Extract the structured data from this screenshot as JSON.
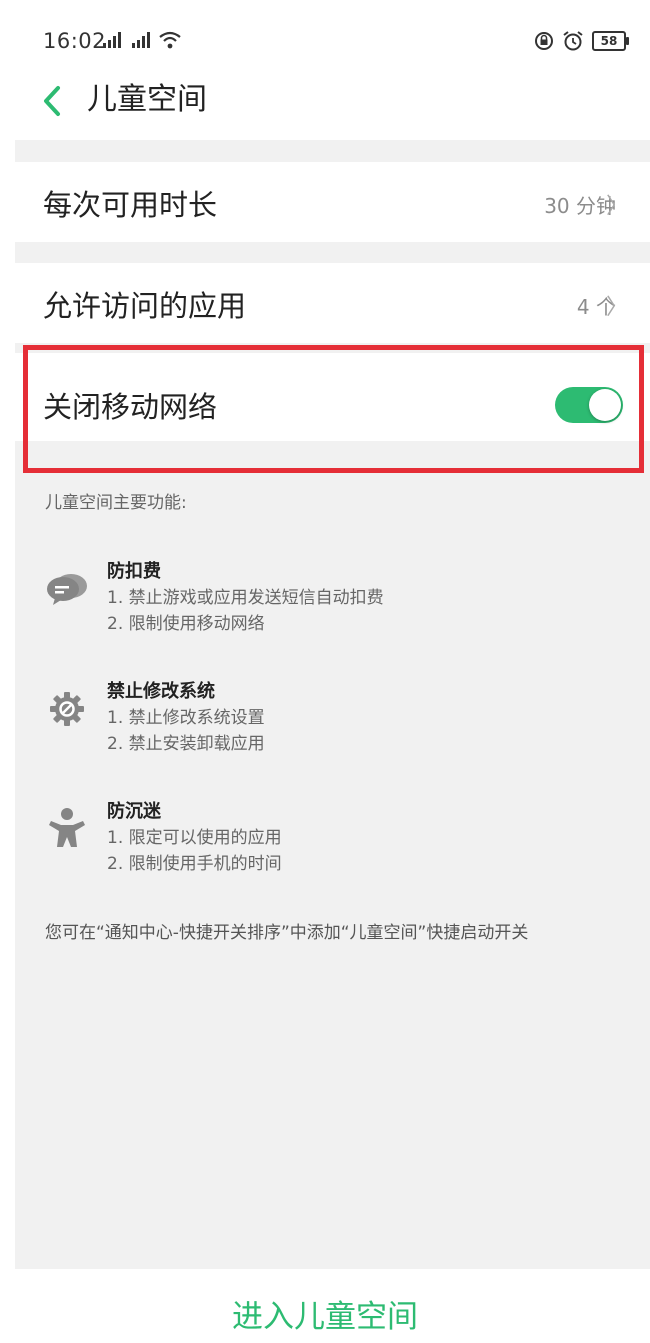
{
  "status_bar": {
    "time": "16:02",
    "battery": "58"
  },
  "header": {
    "title": "儿童空间"
  },
  "settings": {
    "duration_label": "每次可用时长",
    "duration_value": "30 分钟",
    "apps_label": "允许访问的应用",
    "apps_value": "4 个",
    "mobile_label": "关闭移动网络",
    "mobile_on": true
  },
  "features": {
    "title": "儿童空间主要功能:",
    "items": [
      {
        "icon": "chat-bubbles-icon",
        "title": "防扣费",
        "lines": [
          "1. 禁止游戏或应用发送短信自动扣费",
          "2. 限制使用移动网络"
        ]
      },
      {
        "icon": "gear-forbid-icon",
        "title": "禁止修改系统",
        "lines": [
          "1. 禁止修改系统设置",
          "2. 禁止安装卸载应用"
        ]
      },
      {
        "icon": "child-figure-icon",
        "title": "防沉迷",
        "lines": [
          "1. 限定可以使用的应用",
          "2. 限制使用手机的时间"
        ]
      }
    ]
  },
  "note": "您可在“通知中心-快捷开关排序”中添加“儿童空间”快捷启动开关",
  "bottom": {
    "enter_label": "进入儿童空间"
  },
  "colors": {
    "accent": "#2dbb72",
    "highlight": "#e52e37",
    "background": "#f1f1f1"
  }
}
